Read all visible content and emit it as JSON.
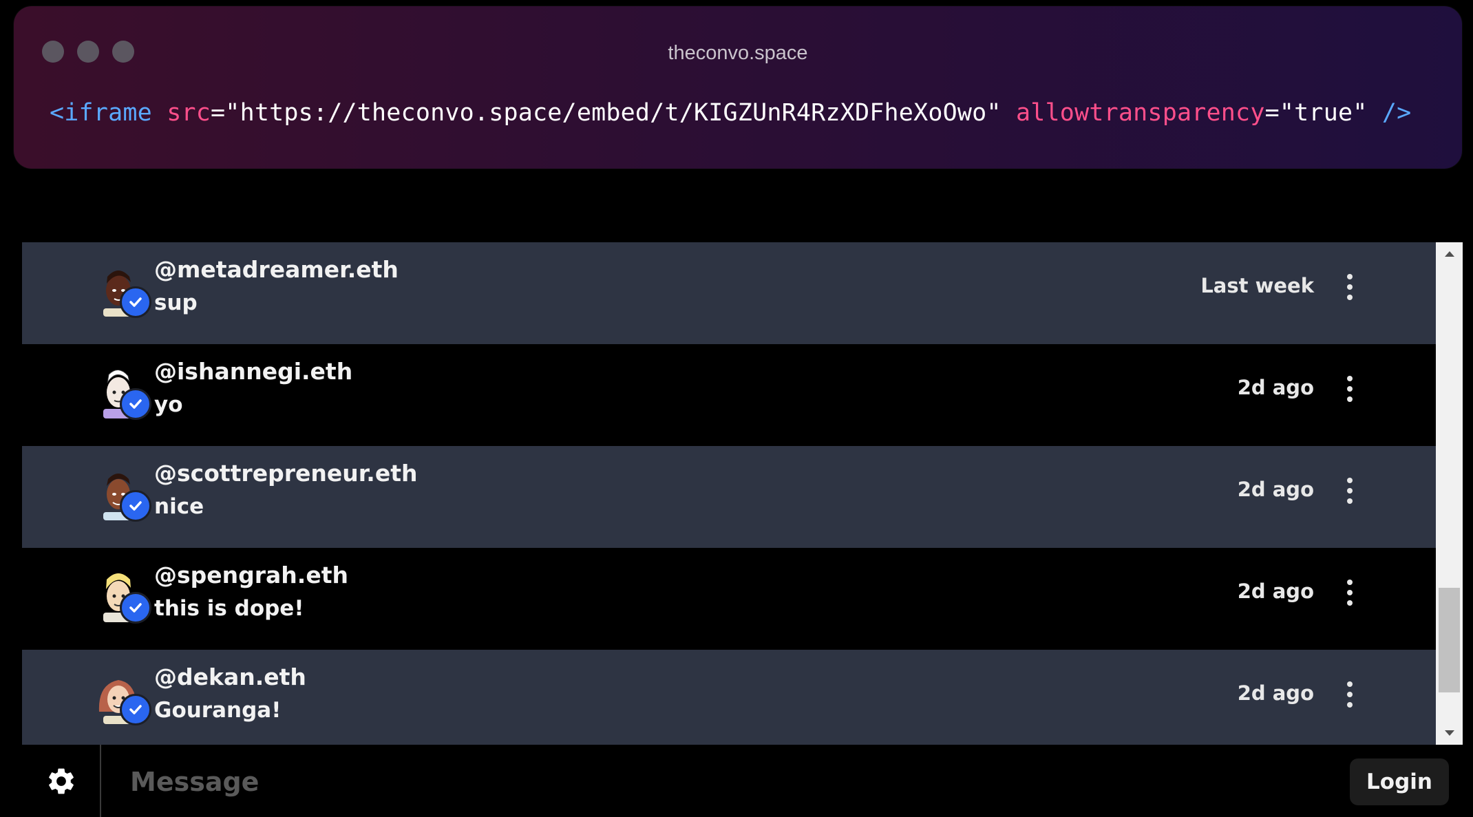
{
  "window": {
    "title": "theconvo.space",
    "code": {
      "open": "<iframe",
      "attr_src": "src",
      "eq": "=",
      "src_value": "\"https://theconvo.space/embed/t/KIGZUnR4RzXDFheXoOwo\"",
      "attr_transparency": "allowtransparency",
      "transparency_value": "\"true\"",
      "close": "/>"
    }
  },
  "messages": [
    {
      "username": "@metadreamer.eth",
      "text": "sup",
      "time": "Last week",
      "avatar": "avatar-dark-skin-man"
    },
    {
      "username": "@ishannegi.eth",
      "text": "yo",
      "time": "2d ago",
      "avatar": "avatar-light-skin-man"
    },
    {
      "username": "@scottrepreneur.eth",
      "text": "nice",
      "time": "2d ago",
      "avatar": "avatar-brown-skin-man"
    },
    {
      "username": "@spengrah.eth",
      "text": "this is dope!",
      "time": "2d ago",
      "avatar": "avatar-blonde-man"
    },
    {
      "username": "@dekan.eth",
      "text": "Gouranga!",
      "time": "2d ago",
      "avatar": "avatar-woman"
    }
  ],
  "composer": {
    "placeholder": "Message",
    "login_label": "Login"
  },
  "colors": {
    "row_alt": "#2e3443",
    "verified": "#2a66f0",
    "code_tag": "#5aa9ff",
    "code_attr": "#ff4f8b"
  }
}
